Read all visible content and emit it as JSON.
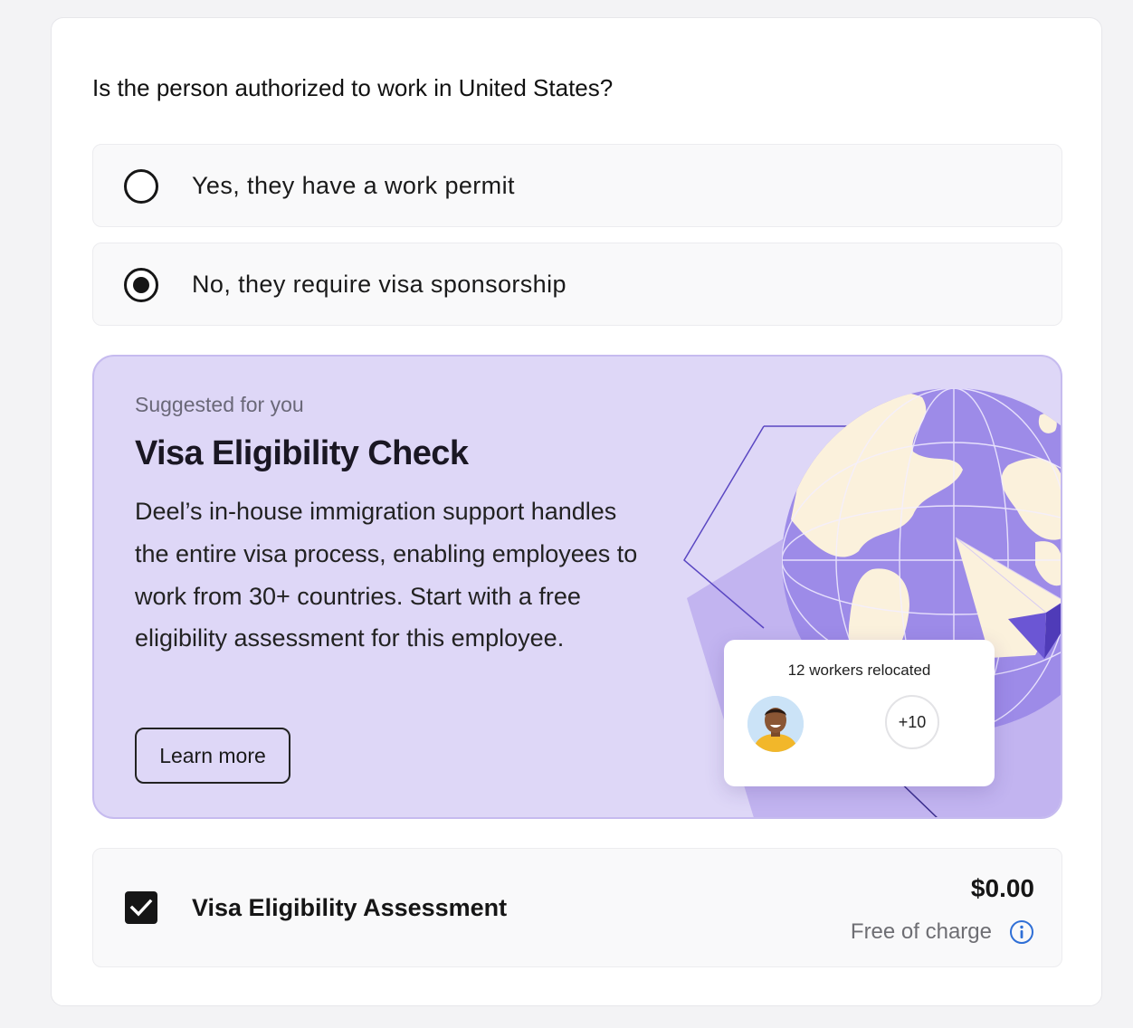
{
  "question": "Is the person authorized to work in United States?",
  "options": [
    {
      "label": "Yes, they have a work permit",
      "selected": false
    },
    {
      "label": "No, they require visa sponsorship",
      "selected": true
    }
  ],
  "promo": {
    "eyebrow": "Suggested for you",
    "title": "Visa Eligibility Check",
    "description": "Deel’s in-house immigration support handles the entire visa process, enabling employees to work from 30+ countries. Start with a free eligibility assessment for this employee.",
    "cta": "Learn more",
    "stat_title": "12 workers relocated",
    "stat_more": "+10",
    "colors": {
      "background": "#ded7f7",
      "globe": "#9d8be8",
      "land": "#fbf1dc"
    }
  },
  "assessment": {
    "checked": true,
    "name": "Visa Eligibility Assessment",
    "price": "$0.00",
    "note": "Free of charge",
    "info_icon": "info-icon"
  },
  "accent_colors": {
    "info": "#2f6fd6",
    "control": "#161616"
  }
}
